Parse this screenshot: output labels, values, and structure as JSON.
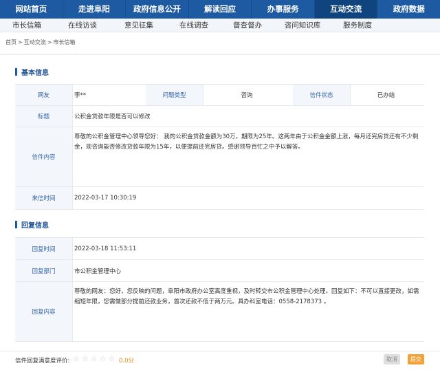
{
  "top_nav": {
    "items": [
      {
        "label": "网站首页"
      },
      {
        "label": "走进阜阳"
      },
      {
        "label": "政府信息公开"
      },
      {
        "label": "解读回应"
      },
      {
        "label": "办事服务"
      },
      {
        "label": "互动交流"
      },
      {
        "label": "政府数据"
      }
    ]
  },
  "sub_nav": {
    "items": [
      {
        "label": "市长信箱"
      },
      {
        "label": "在线访谈"
      },
      {
        "label": "意见征集"
      },
      {
        "label": "在线调查"
      },
      {
        "label": "督查督办"
      },
      {
        "label": "咨问知识库"
      },
      {
        "label": "服务制度"
      }
    ]
  },
  "breadcrumb": {
    "home": "首页",
    "sep1": ">",
    "section": "互动交流",
    "sep2": ">",
    "current": "市长信箱"
  },
  "basic_info": {
    "title": "基本信息",
    "sender_label": "网友",
    "sender_value": "李**",
    "type_label": "问题类型",
    "type_value": "咨询",
    "status_label": "信件状态",
    "status_value": "已办结",
    "subject_label": "标题",
    "subject_value": "公积金贷款年限是否可以修改",
    "content_label": "信件内容",
    "content_value": "尊敬的公积金管理中心领导您好：  我的公积金贷款金额为30万，期限为25年。这两年由于公积金金额上涨，每月还完房贷还有不少剩余，现咨询能否修改贷款年限为15年，以便提前还完房贷。感谢领导百忙之中予以解答。",
    "time_label": "来信时间",
    "time_value": "2022-03-17 10:30:19"
  },
  "reply_info": {
    "title": "回复信息",
    "time_label": "回复时间",
    "time_value": "2022-03-18 11:53:11",
    "dept_label": "回复部门",
    "dept_value": "市公积金管理中心",
    "content_label": "回复内容",
    "content_value": "尊敬的网友：您好，您反映的问题，阜阳市政府办公室高度重视，及时转交市公积金管理中心处理。回复如下：不可以直接更改，如需缩短年限，您需做部分提前还款业务，首次还款不低于两万元。具办科室电话：0558-2178373 。"
  },
  "rating": {
    "label": "信件回复满意度评价:",
    "stars": [
      "☆",
      "☆",
      "☆",
      "☆",
      "☆"
    ],
    "score": "0.0分",
    "cancel_label": "取消",
    "submit_label": "提交"
  },
  "colors": {
    "nav_bg": "#1d5aa2",
    "nav_active": "#0f447f",
    "label_text": "#3363a8",
    "score": "#e98b16",
    "submit_bg": "#f3a23a"
  }
}
